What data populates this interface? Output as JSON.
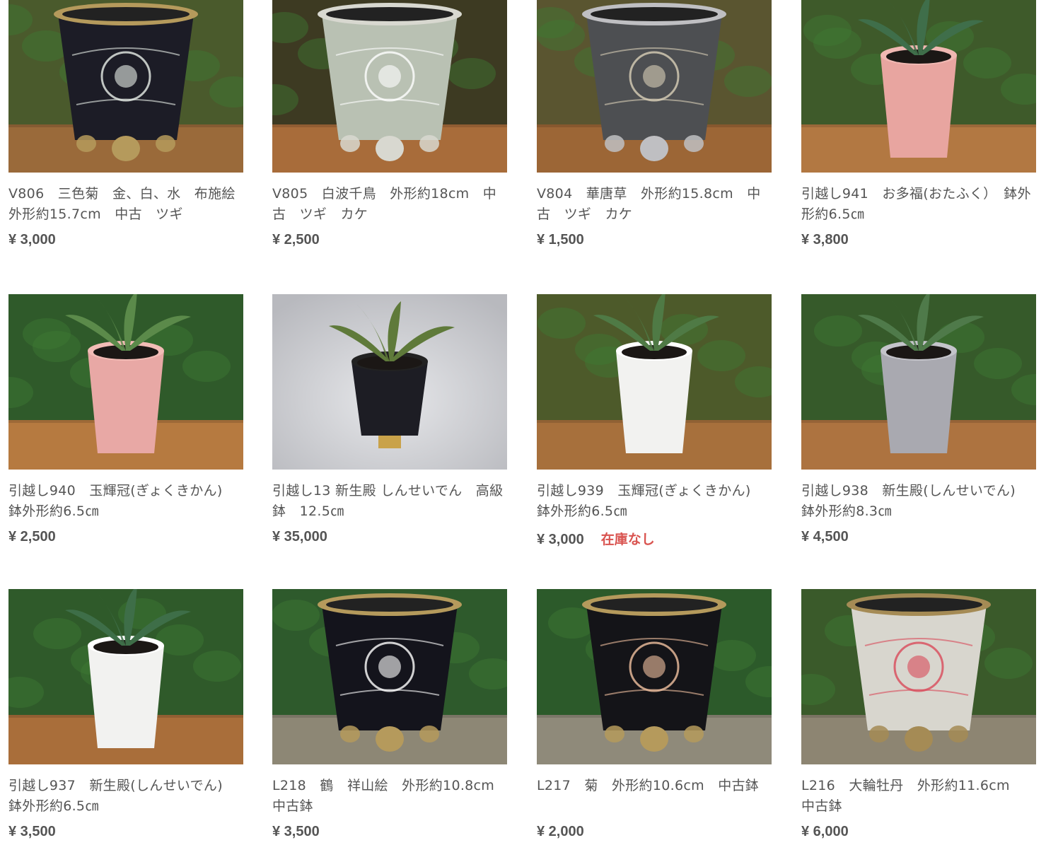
{
  "products": [
    {
      "title": "V806　三色菊　金、白、水　布施絵　外形約15.7cm　中古　ツギ",
      "price": "¥ 3,000",
      "sold_out": "",
      "photo": "black-glazed-pot-white-flower-pattern"
    },
    {
      "title": "V805　白波千鳥　外形約18cm　中古　ツギ　カケ",
      "price": "¥ 2,500",
      "sold_out": "",
      "photo": "grey-pot-wave-pattern"
    },
    {
      "title": "V804　華唐草　外形約15.8cm　中古　ツギ　カケ",
      "price": "¥ 1,500",
      "sold_out": "",
      "photo": "arabesque-pattern-pot"
    },
    {
      "title": "引越し941　お多福(おたふく）　鉢外形約6.5㎝",
      "price": "¥ 3,800",
      "sold_out": "",
      "photo": "pink-pot-wide-leaf-plant"
    },
    {
      "title": "引越し940　玉輝冠(ぎょくきかん)　鉢外形約6.5㎝",
      "price": "¥ 2,500",
      "sold_out": "",
      "photo": "pink-pot-variegated-plant"
    },
    {
      "title": "引越し13 新生殿 しんせいでん　高級鉢　12.5㎝",
      "price": "¥ 35,000",
      "sold_out": "",
      "photo": "dragon-pot-studio-plant"
    },
    {
      "title": "引越し939　玉輝冠(ぎょくきかん)　鉢外形約6.5㎝",
      "price": "¥ 3,000",
      "sold_out": "在庫なし",
      "photo": "white-pot-plant"
    },
    {
      "title": "引越し938　新生殿(しんせいでん)　鉢外形約8.3㎝",
      "price": "¥ 4,500",
      "sold_out": "",
      "photo": "grey-pot-plant"
    },
    {
      "title": "引越し937　新生殿(しんせいでん)　鉢外形約6.5㎝",
      "price": "¥ 3,500",
      "sold_out": "",
      "photo": "white-pot-wide-leaf-plant"
    },
    {
      "title": "L218　鶴　祥山絵　外形約10.8cm　中古鉢",
      "price": "¥ 3,500",
      "sold_out": "",
      "photo": "crane-painted-pot"
    },
    {
      "title": "L217　菊　外形約10.6cm　中古鉢",
      "price": "¥ 2,000",
      "sold_out": "",
      "photo": "chrysanthemum-black-pot"
    },
    {
      "title": "L216　大輪牡丹　外形約11.6cm　中古鉢",
      "price": "¥ 6,000",
      "sold_out": "",
      "photo": "peony-painted-pot"
    }
  ],
  "colors": {
    "text": "#555555",
    "sold_out": "#d9534f",
    "background": "#ffffff"
  }
}
